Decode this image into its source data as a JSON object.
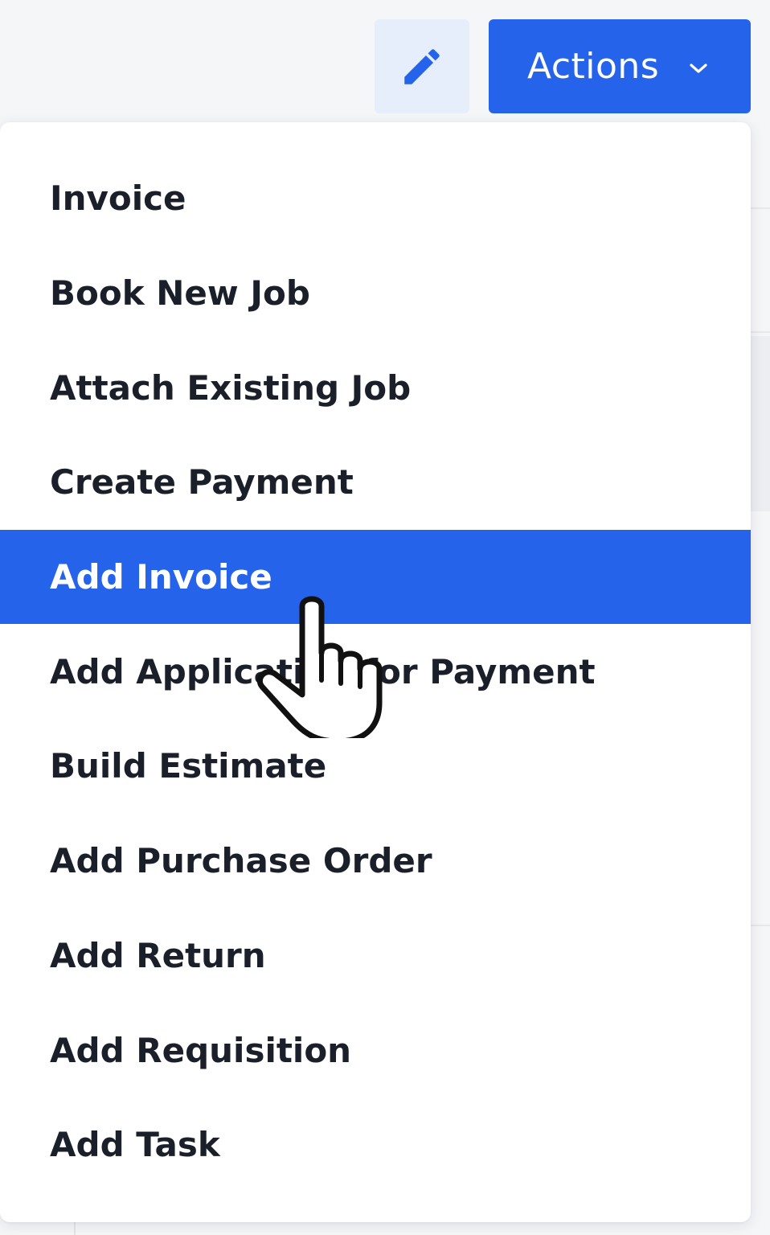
{
  "toolbar": {
    "edit_icon": "pencil-icon",
    "actions_label": "Actions",
    "actions_icon": "chevron-down-icon"
  },
  "menu": {
    "items": [
      {
        "label": "Invoice",
        "active": false
      },
      {
        "label": "Book New Job",
        "active": false
      },
      {
        "label": "Attach Existing Job",
        "active": false
      },
      {
        "label": "Create Payment",
        "active": false
      },
      {
        "label": "Add Invoice",
        "active": true
      },
      {
        "label": "Add Application for Payment",
        "active": false
      },
      {
        "label": "Build Estimate",
        "active": false
      },
      {
        "label": "Add Purchase Order",
        "active": false
      },
      {
        "label": "Add Return",
        "active": false
      },
      {
        "label": "Add Requisition",
        "active": false
      },
      {
        "label": "Add Task",
        "active": false
      }
    ]
  },
  "cursor": {
    "icon": "hand-pointer-icon"
  },
  "colors": {
    "accent": "#2563eb",
    "edit_button_bg": "#e6eefb",
    "text": "#1b1f2a"
  }
}
